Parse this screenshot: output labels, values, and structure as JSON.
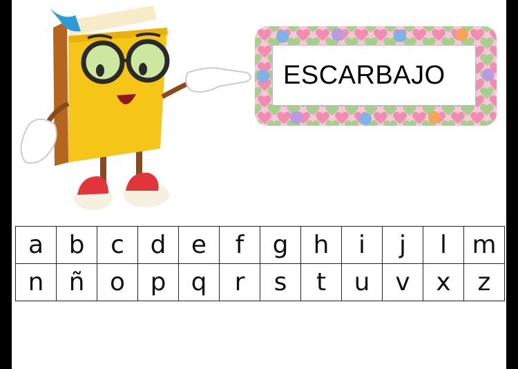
{
  "word": "ESCARBAJO",
  "alphabet": {
    "rows": [
      [
        "a",
        "b",
        "c",
        "d",
        "e",
        "f",
        "g",
        "h",
        "i",
        "j",
        "l",
        "m"
      ],
      [
        "n",
        "ñ",
        "o",
        "p",
        "q",
        "r",
        "s",
        "t",
        "u",
        "v",
        "x",
        "z"
      ]
    ]
  },
  "colors": {
    "book_cover": "#F5C518",
    "book_spine": "#B5651D",
    "bookmark": "#2E9BD6",
    "shoes": "#E0353B",
    "glasses_lens": "#CDE6A0"
  },
  "icons": [
    "book-mascot-icon",
    "heart-frame-icon"
  ]
}
